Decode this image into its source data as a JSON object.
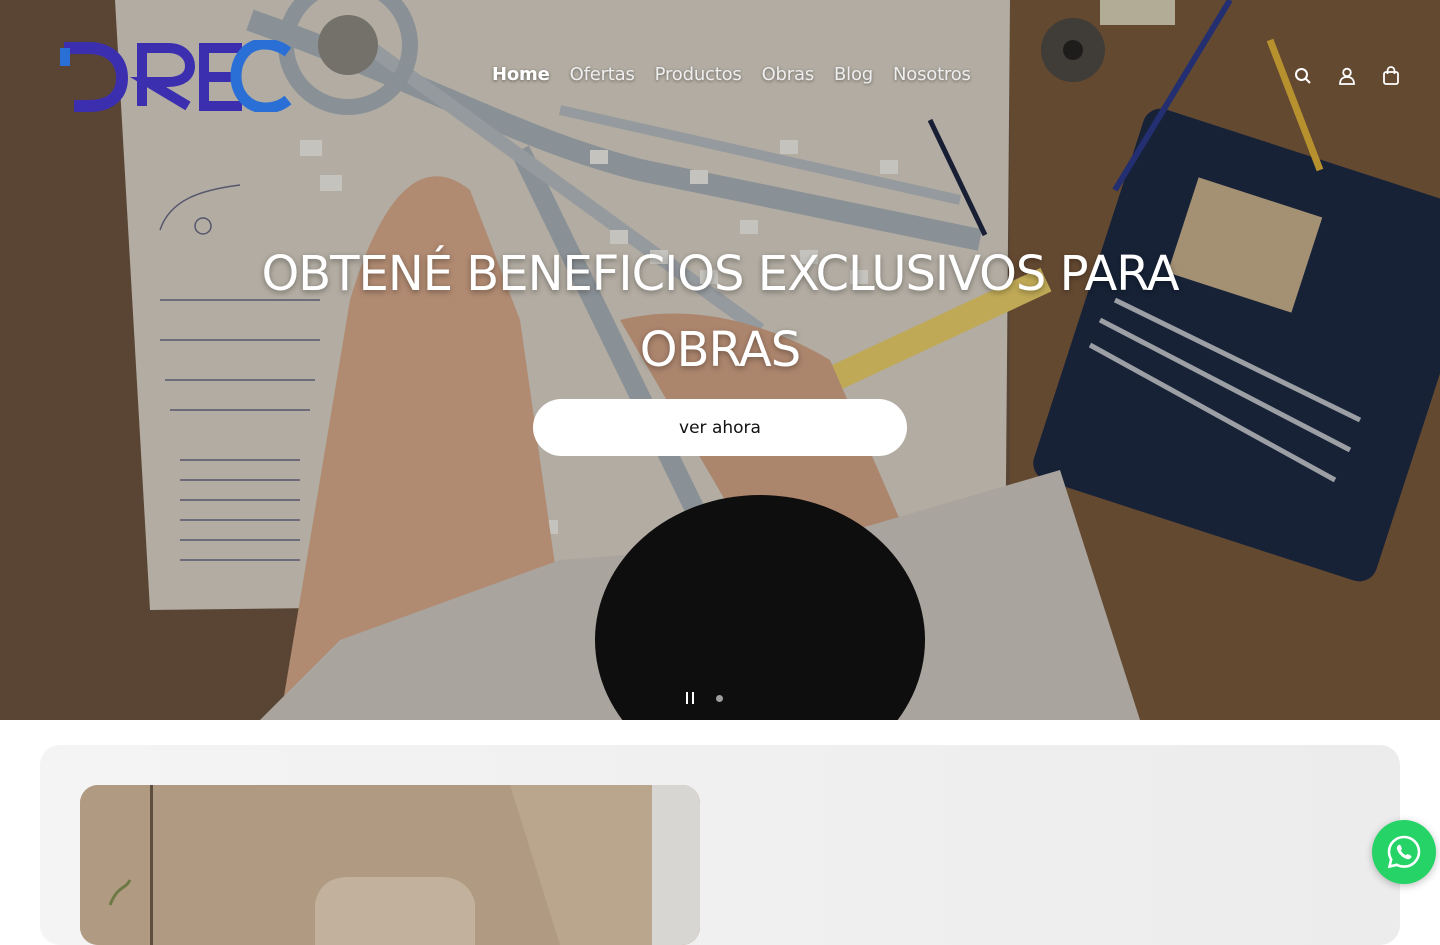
{
  "header": {
    "logo_text": "DREC",
    "nav": [
      {
        "label": "Home",
        "active": true
      },
      {
        "label": "Ofertas",
        "active": false
      },
      {
        "label": "Productos",
        "active": false
      },
      {
        "label": "Obras",
        "active": false
      },
      {
        "label": "Blog",
        "active": false
      },
      {
        "label": "Nosotros",
        "active": false
      }
    ],
    "icons": [
      "search-icon",
      "account-icon",
      "cart-icon"
    ]
  },
  "hero": {
    "title": "OBTENÉ BENEFICIOS EXCLUSIVOS PARA OBRAS",
    "cta_label": "ver ahora",
    "slider": {
      "pause_icon": "pause-icon",
      "slides": 2,
      "current": 1
    }
  },
  "floating": {
    "whatsapp_icon": "whatsapp-icon"
  },
  "colors": {
    "logo_primary": "#3b2fb0",
    "logo_secondary": "#2a6fd6",
    "whatsapp": "#25d366",
    "cta_bg": "#ffffff"
  }
}
